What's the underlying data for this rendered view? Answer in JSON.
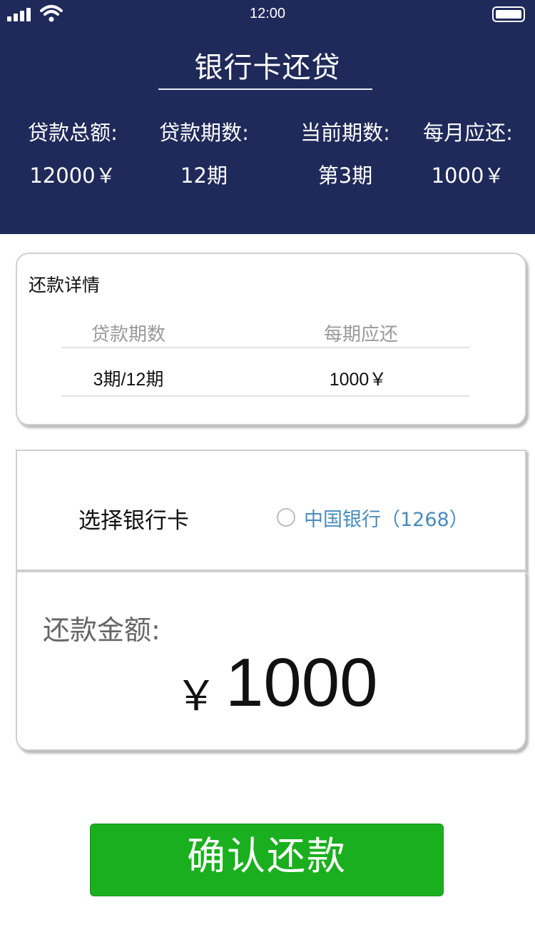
{
  "status_bar": {
    "time": "12:00"
  },
  "header": {
    "title": "银行卡还贷",
    "stats": [
      {
        "label": "贷款总额:",
        "value": "12000￥"
      },
      {
        "label": "贷款期数:",
        "value": "12期"
      },
      {
        "label": "当前期数:",
        "value": "第3期"
      },
      {
        "label": "每月应还:",
        "value": "1000￥"
      }
    ],
    "background_color": "#1f2a5a"
  },
  "details": {
    "heading": "还款详情",
    "columns": [
      "贷款期数",
      "每期应还"
    ],
    "rows": [
      [
        "3期/12期",
        "1000￥"
      ]
    ]
  },
  "bank": {
    "label": "选择银行卡",
    "option": "中国银行（1268）",
    "option_color": "#4a8bbd"
  },
  "amount": {
    "label": "还款金额:",
    "currency": "￥",
    "value": "1000"
  },
  "confirm_button": {
    "label": "确认还款",
    "color": "#1aaf1e"
  }
}
